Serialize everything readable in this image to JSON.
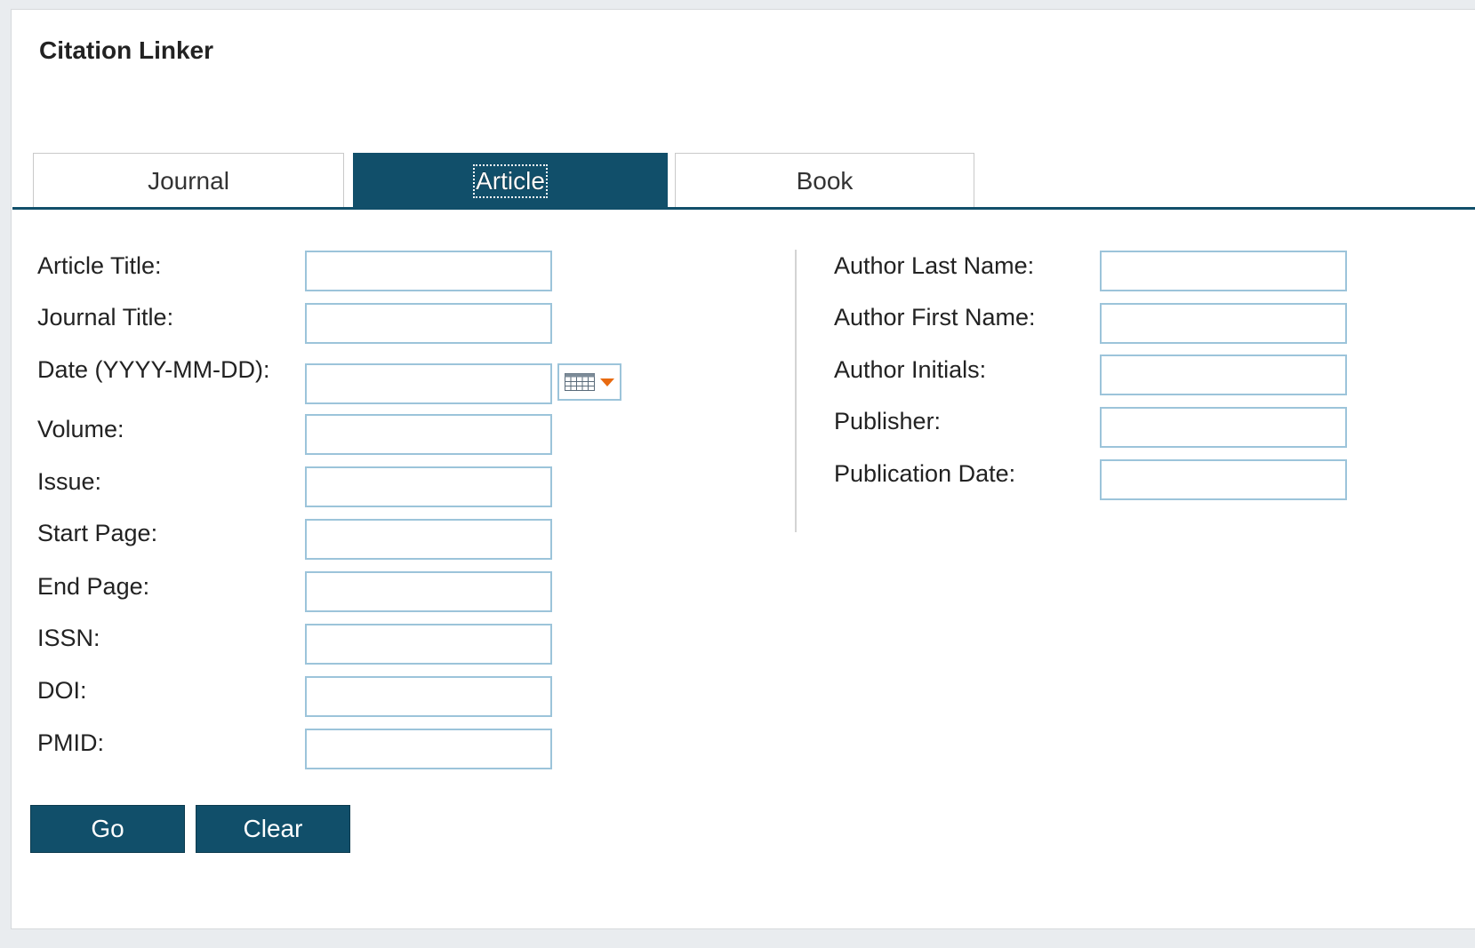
{
  "header": {
    "title": "Citation Linker"
  },
  "tabs": [
    {
      "label": "Journal",
      "active": false
    },
    {
      "label": "Article",
      "active": true
    },
    {
      "label": "Book",
      "active": false
    }
  ],
  "left_fields": [
    {
      "label": "Article Title:",
      "value": ""
    },
    {
      "label": "Journal Title:",
      "value": ""
    },
    {
      "label": "Date (YYYY-MM-DD):",
      "value": ""
    },
    {
      "label": "Volume:",
      "value": ""
    },
    {
      "label": "Issue:",
      "value": ""
    },
    {
      "label": "Start Page:",
      "value": ""
    },
    {
      "label": "End Page:",
      "value": ""
    },
    {
      "label": "ISSN:",
      "value": ""
    },
    {
      "label": "DOI:",
      "value": ""
    },
    {
      "label": "PMID:",
      "value": ""
    }
  ],
  "right_fields": [
    {
      "label": "Author Last Name:",
      "value": ""
    },
    {
      "label": "Author First Name:",
      "value": ""
    },
    {
      "label": "Author Initials:",
      "value": ""
    },
    {
      "label": "Publisher:",
      "value": ""
    },
    {
      "label": "Publication Date:",
      "value": ""
    }
  ],
  "date_picker": {
    "icon": "calendar-icon",
    "arrow_icon": "dropdown-arrow-icon",
    "arrow_color": "#e86a10"
  },
  "buttons": {
    "go_label": "Go",
    "clear_label": "Clear"
  },
  "colors": {
    "accent": "#114f6a",
    "field_border": "#9cc4da"
  }
}
